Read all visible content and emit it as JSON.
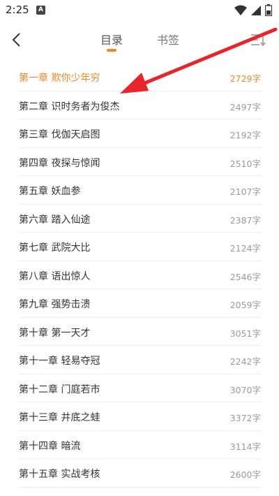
{
  "status_bar": {
    "time": "2:25",
    "app_icon_letter": "A",
    "icons": [
      "wifi-icon",
      "signal-icon",
      "battery-icon"
    ]
  },
  "header": {
    "tabs": [
      {
        "label": "目录",
        "active": true
      },
      {
        "label": "书签",
        "active": false
      }
    ],
    "accent_color": "#f0892b"
  },
  "chapters": [
    {
      "title": "第一章  欺你少年穷",
      "count": "2729字",
      "current": true
    },
    {
      "title": "第二章  识时务者为俊杰",
      "count": "2497字"
    },
    {
      "title": "第三章  伐伽天启图",
      "count": "2192字"
    },
    {
      "title": "第四章  夜探与惊闻",
      "count": "2510字"
    },
    {
      "title": "第五章  妖血参",
      "count": "2107字"
    },
    {
      "title": "第六章  踏入仙途",
      "count": "2387字"
    },
    {
      "title": "第七章  武院大比",
      "count": "2124字"
    },
    {
      "title": "第八章  语出惊人",
      "count": "2546字"
    },
    {
      "title": "第九章  强势击溃",
      "count": "2059字"
    },
    {
      "title": "第十章  第一天才",
      "count": "3051字"
    },
    {
      "title": "第十一章  轻易夺冠",
      "count": "2242字"
    },
    {
      "title": "第十二章  门庭若市",
      "count": "3070字"
    },
    {
      "title": "第十三章  井底之蛙",
      "count": "3372字"
    },
    {
      "title": "第十四章  暗流",
      "count": "3114字"
    },
    {
      "title": "第十五章  实战考核",
      "count": "2600字"
    }
  ]
}
